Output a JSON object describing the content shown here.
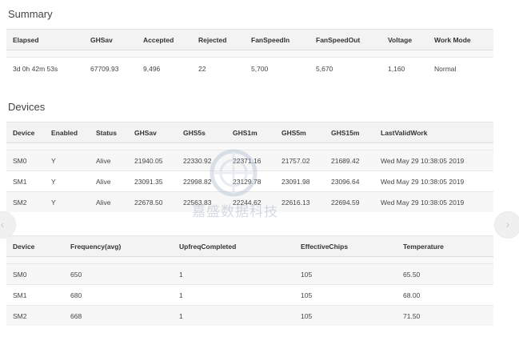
{
  "summary": {
    "title": "Summary",
    "columns": [
      "Elapsed",
      "GHSav",
      "Accepted",
      "Rejected",
      "FanSpeedIn",
      "FanSpeedOut",
      "Voltage",
      "Work Mode"
    ],
    "row": [
      "3d 0h 42m 53s",
      "67709.93",
      "9,496",
      "22",
      "5,700",
      "5,670",
      "1,160",
      "Normal"
    ]
  },
  "devices": {
    "title": "Devices",
    "columns": [
      "Device",
      "Enabled",
      "Status",
      "GHSav",
      "GHS5s",
      "GHS1m",
      "GHS5m",
      "GHS15m",
      "LastValidWork"
    ],
    "rows": [
      [
        "SM0",
        "Y",
        "Alive",
        "21940.05",
        "22330.92",
        "22371.16",
        "21757.02",
        "21689.42",
        "Wed May 29 10:38:05 2019"
      ],
      [
        "SM1",
        "Y",
        "Alive",
        "23091.35",
        "22998.82",
        "23129.78",
        "23091.98",
        "23096.64",
        "Wed May 29 10:38:05 2019"
      ],
      [
        "SM2",
        "Y",
        "Alive",
        "22678.50",
        "22563.83",
        "22244.62",
        "22616.13",
        "22694.59",
        "Wed May 29 10:38:05 2019"
      ]
    ]
  },
  "chips": {
    "columns": [
      "Device",
      "Frequency(avg)",
      "UpfreqCompleted",
      "EffectiveChips",
      "Temperature"
    ],
    "rows": [
      [
        "SM0",
        "650",
        "1",
        "105",
        "65.50"
      ],
      [
        "SM1",
        "680",
        "1",
        "105",
        "68.00"
      ],
      [
        "SM2",
        "668",
        "1",
        "105",
        "71.50"
      ]
    ]
  },
  "watermark": {
    "text": "嘉盛数据科技",
    "icon": "watermark-logo-icon"
  },
  "nav": {
    "prev_icon": "chevron-left-icon",
    "next_icon": "chevron-right-icon",
    "prev_glyph": "‹",
    "next_glyph": "›"
  }
}
